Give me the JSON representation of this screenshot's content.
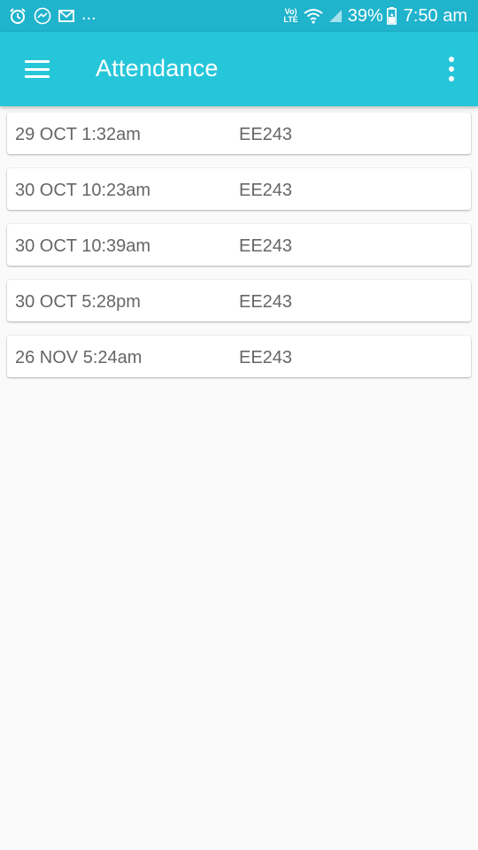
{
  "status_bar": {
    "left_icons": [
      "alarm-icon",
      "messenger-icon",
      "gmail-icon"
    ],
    "more_indicator": "...",
    "lte_top": "Vo)",
    "lte_bottom": "LTE",
    "battery_percent": "39%",
    "time": "7:50 am"
  },
  "app_bar": {
    "title": "Attendance",
    "menu_icon": "hamburger-menu-icon",
    "overflow_icon": "more-vert-icon",
    "color": "#26c6da"
  },
  "records": [
    {
      "time": "29 OCT 1:32am",
      "course": "EE243"
    },
    {
      "time": "30 OCT 10:23am",
      "course": "EE243"
    },
    {
      "time": "30 OCT 10:39am",
      "course": "EE243"
    },
    {
      "time": "30 OCT 5:28pm",
      "course": "EE243"
    },
    {
      "time": "26 NOV 5:24am",
      "course": "EE243"
    }
  ]
}
